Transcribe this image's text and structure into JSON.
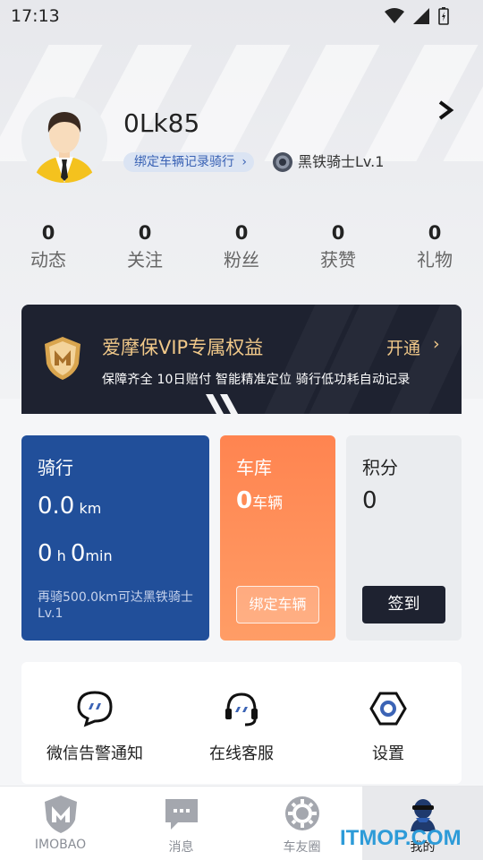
{
  "status_bar": {
    "time": "17:13"
  },
  "profile": {
    "username": "0Lk85",
    "bind_tag": "绑定车辆记录骑行",
    "rank": "黑铁骑士Lv.1"
  },
  "stats": [
    {
      "value": "0",
      "label": "动态"
    },
    {
      "value": "0",
      "label": "关注"
    },
    {
      "value": "0",
      "label": "粉丝"
    },
    {
      "value": "0",
      "label": "获赞"
    },
    {
      "value": "0",
      "label": "礼物"
    }
  ],
  "vip": {
    "title": "爱摩保VIP专属权益",
    "open_label": "开通",
    "description": "保障齐全  10日赔付  智能精准定位  骑行低功耗自动记录"
  },
  "ride": {
    "title": "骑行",
    "distance": "0.0",
    "distance_unit": "km",
    "hours": "0",
    "hours_unit": "h",
    "minutes": "0",
    "minutes_unit": "min",
    "note": "再骑500.0km可达黑铁骑士Lv.1"
  },
  "garage": {
    "title": "车库",
    "count": "0",
    "count_unit": "车辆",
    "button": "绑定车辆"
  },
  "points": {
    "title": "积分",
    "value": "0",
    "button": "签到"
  },
  "tools": [
    {
      "label": "微信告警通知",
      "icon": "wechat-alert-icon"
    },
    {
      "label": "在线客服",
      "icon": "headset-icon"
    },
    {
      "label": "设置",
      "icon": "settings-hex-icon"
    }
  ],
  "tabs": [
    {
      "label": "IMOBAO",
      "icon": "imobao-shield-icon"
    },
    {
      "label": "消息",
      "icon": "message-icon"
    },
    {
      "label": "车友圈",
      "icon": "gear-icon"
    },
    {
      "label": "我的",
      "icon": "rider-icon",
      "active": true
    }
  ],
  "watermark": "ITMOP.COM",
  "colors": {
    "ride_card": "#214f9a",
    "garage_card": "#ff8450",
    "vip_bg": "#1e2230",
    "vip_gold": "#f0c889",
    "accent_blue": "#3b63b5"
  }
}
